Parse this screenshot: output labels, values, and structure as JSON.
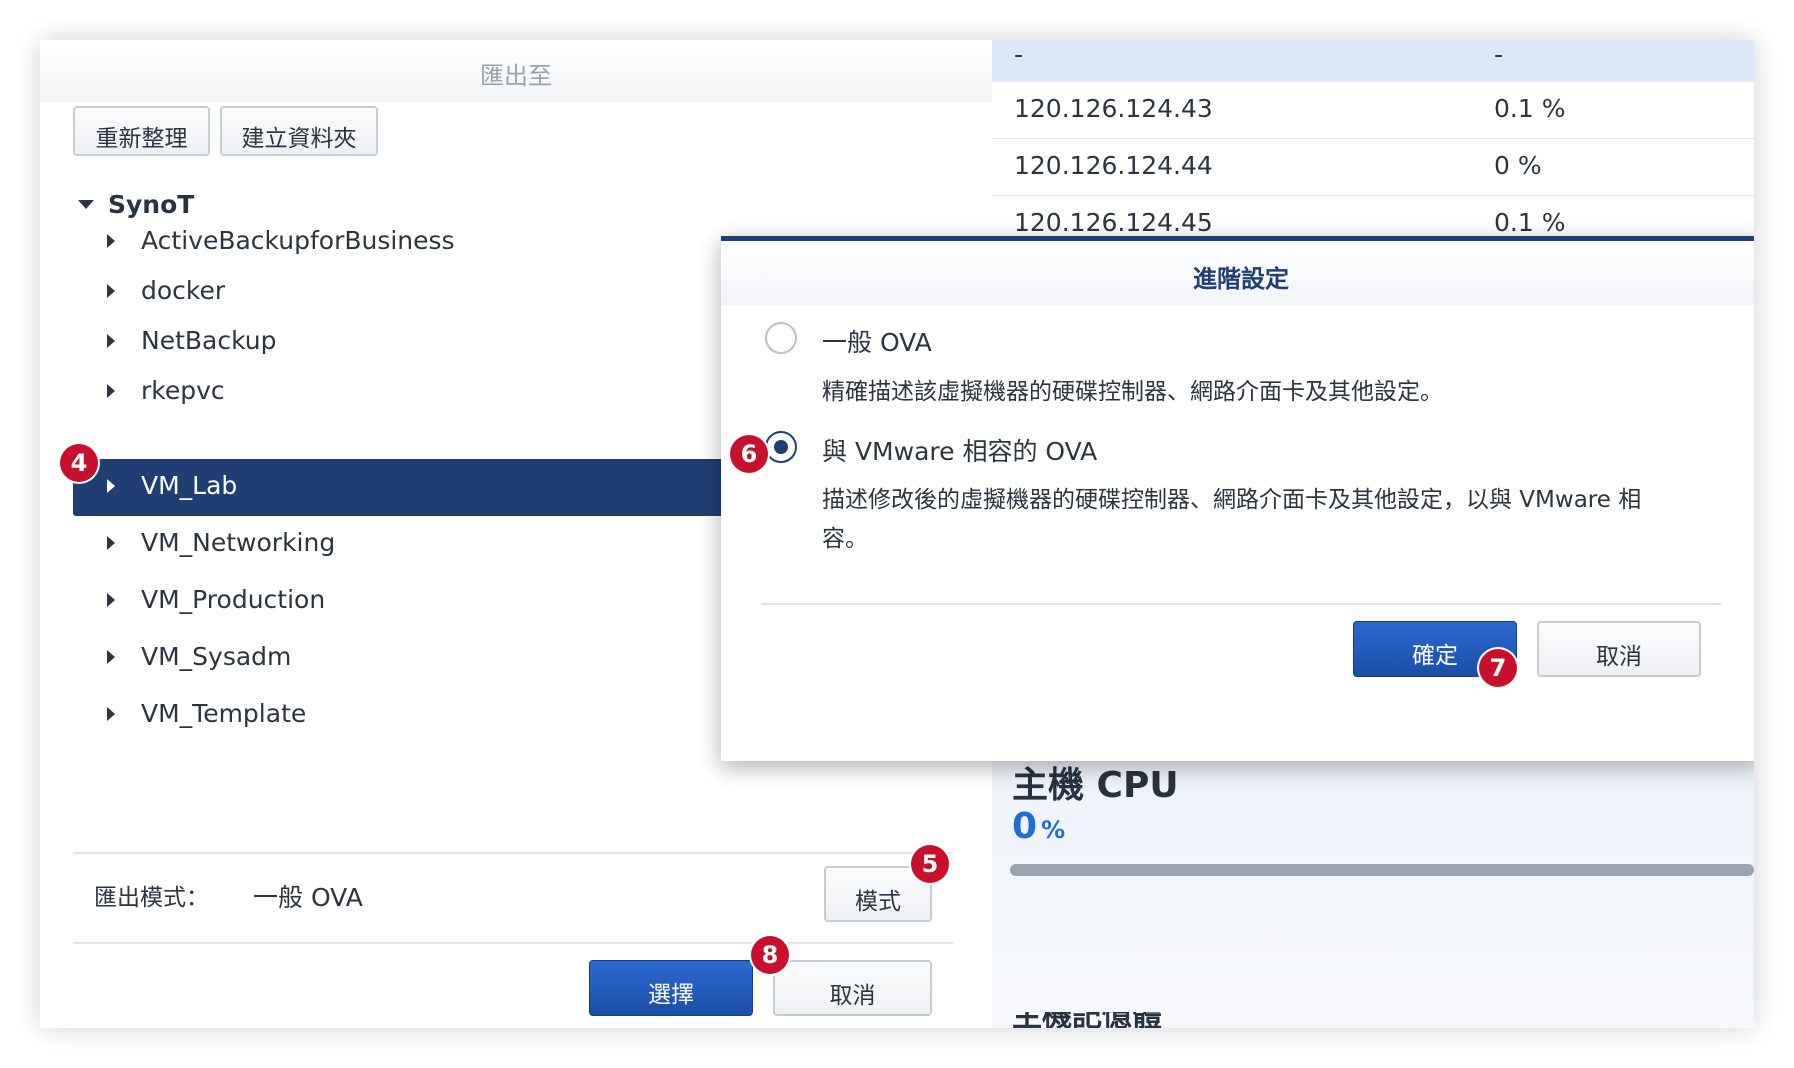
{
  "export_panel": {
    "title": "匯出至",
    "refresh_label": "重新整理",
    "new_folder_label": "建立資料夾",
    "tree": {
      "root": "SynoT",
      "items": [
        {
          "label": "ActiveBackupforBusiness",
          "selected": false
        },
        {
          "label": "docker",
          "selected": false
        },
        {
          "label": "NetBackup",
          "selected": false
        },
        {
          "label": "rkepvc",
          "selected": false
        },
        {
          "label": "VM_Lab",
          "selected": true
        },
        {
          "label": "VM_Networking",
          "selected": false
        },
        {
          "label": "VM_Production",
          "selected": false
        },
        {
          "label": "VM_Sysadm",
          "selected": false
        },
        {
          "label": "VM_Template",
          "selected": false
        }
      ]
    },
    "export_mode_label": "匯出模式：",
    "export_mode_value": "一般 OVA",
    "mode_button_label": "模式",
    "select_button_label": "選擇",
    "cancel_button_label": "取消"
  },
  "background_panel": {
    "table_rows": [
      {
        "ip": "-",
        "value": "-",
        "highlighted": true
      },
      {
        "ip": "120.126.124.43",
        "value": "0.1 %",
        "highlighted": false
      },
      {
        "ip": "120.126.124.44",
        "value": "0 %",
        "highlighted": false
      },
      {
        "ip": "120.126.124.45",
        "value": "0.1 %",
        "highlighted": false
      }
    ],
    "host_cpu_title": "主機 CPU",
    "host_cpu_value": "0",
    "host_cpu_unit": "%",
    "host_cpu_progress": 0,
    "next_section_title_partial": "主機記憶體"
  },
  "advanced_dialog": {
    "title": "進階設定",
    "options": [
      {
        "label": "一般 OVA",
        "description": "精確描述該虛擬機器的硬碟控制器、網路介面卡及其他設定。",
        "selected": false
      },
      {
        "label": "與 VMware 相容的 OVA",
        "description": "描述修改後的虛擬機器的硬碟控制器、網路介面卡及其他設定，以與 VMware 相容。",
        "selected": true
      }
    ],
    "confirm_label": "確定",
    "cancel_label": "取消"
  },
  "step_badges": [
    "4",
    "5",
    "6",
    "7",
    "8"
  ],
  "colors": {
    "accent": "#1f3f72",
    "primary_button": "#2360c4",
    "badge": "#c8102e",
    "cpu_value": "#1f6fd1"
  }
}
